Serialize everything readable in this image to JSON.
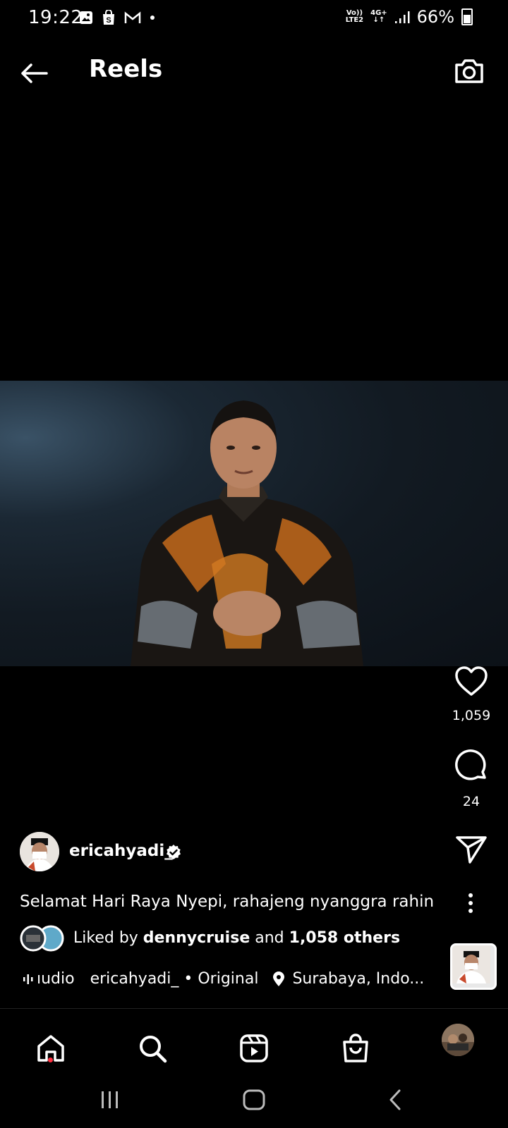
{
  "status_bar": {
    "time": "19:22",
    "network_top": "Vo))",
    "network_bottom": "LTE2",
    "network_gen": "4G+",
    "battery": "66%",
    "left_icons": [
      "gallery-icon",
      "shop-icon",
      "gmail-icon",
      "dot-icon"
    ]
  },
  "header": {
    "title": "Reels"
  },
  "actions": {
    "likes": "1,059",
    "comments": "24"
  },
  "post": {
    "username": "ericahyadi_",
    "caption": "Selamat Hari Raya Nyepi, rahajeng nyanggra rahin ...",
    "liked_prefix": "Liked by ",
    "liked_user": "dennycruise",
    "liked_middle": " and ",
    "liked_others": "1,058 others",
    "audio_label": "ıudio",
    "audio_source": "ericahyadi_ • Original",
    "location": "Surabaya, Indo..."
  },
  "colors": {
    "background": "#000000",
    "text": "#ffffff",
    "notification_dot": "#ff3040",
    "verified": "#ffffff"
  }
}
